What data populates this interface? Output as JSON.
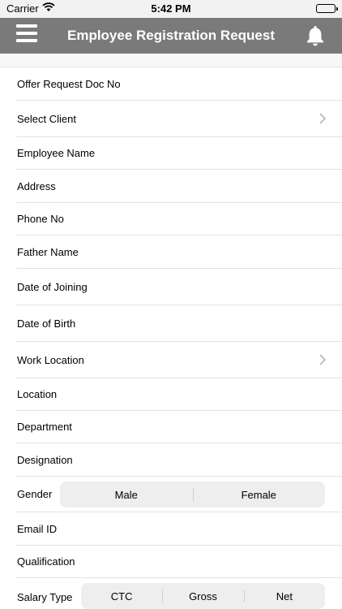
{
  "status_bar": {
    "carrier": "Carrier",
    "time": "5:42 PM"
  },
  "nav": {
    "title": "Employee Registration Request",
    "menu_icon": "hamburger-menu-icon",
    "bell_icon": "bell-icon"
  },
  "form": {
    "offer_request_doc_no": "Offer Request Doc No",
    "select_client": "Select Client",
    "employee_name": "Employee Name",
    "address": "Address",
    "phone_no": "Phone No",
    "father_name": "Father Name",
    "date_of_joining": "Date of Joining",
    "date_of_birth": "Date of Birth",
    "work_location": "Work Location",
    "location": "Location",
    "department": "Department",
    "designation": "Designation",
    "gender": {
      "label": "Gender",
      "options": [
        "Male",
        "Female"
      ]
    },
    "email_id": "Email ID",
    "qualification": "Qualification",
    "salary_type": {
      "label": "Salary Type",
      "options": [
        "CTC",
        "Gross",
        "Net"
      ]
    }
  }
}
